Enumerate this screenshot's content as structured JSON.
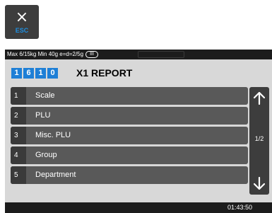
{
  "esc_button": {
    "symbol": "×",
    "label": "ESC",
    "icon": "close-icon"
  },
  "status_bar": {
    "text": "Max 6/15kg Min 40g e=d=2/5g",
    "range_badge": "III"
  },
  "header": {
    "digits": [
      "1",
      "6",
      "1",
      "0"
    ],
    "title": "X1 REPORT"
  },
  "menu": {
    "items": [
      {
        "num": "1",
        "label": "Scale"
      },
      {
        "num": "2",
        "label": "PLU"
      },
      {
        "num": "3",
        "label": "Misc. PLU"
      },
      {
        "num": "4",
        "label": "Group"
      },
      {
        "num": "5",
        "label": "Department"
      }
    ]
  },
  "pager": {
    "page": "1/2",
    "up_icon": "arrow-up-icon",
    "down_icon": "arrow-down-icon"
  },
  "bottom_bar": {
    "time": "01:43:50"
  },
  "colors": {
    "accent": "#1e7fd6",
    "esc_label": "#1e8fe0",
    "menu_bg": "#595959",
    "dark": "#1c1c1c"
  }
}
